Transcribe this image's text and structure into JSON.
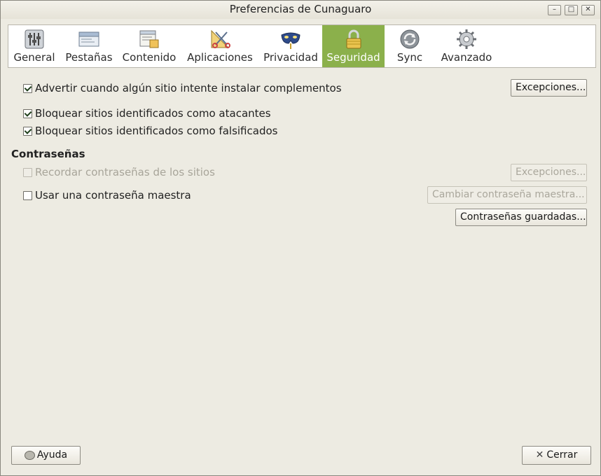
{
  "window": {
    "title": "Preferencias de Cunaguaro",
    "controls": [
      "minimize-icon",
      "maximize-icon",
      "close-icon"
    ]
  },
  "tabs": [
    {
      "label": "General",
      "icon": "sliders-icon",
      "selected": false
    },
    {
      "label": "Pestañas",
      "icon": "tabs-icon",
      "selected": false
    },
    {
      "label": "Contenido",
      "icon": "content-icon",
      "selected": false
    },
    {
      "label": "Aplicaciones",
      "icon": "applications-icon",
      "selected": false
    },
    {
      "label": "Privacidad",
      "icon": "mask-icon",
      "selected": false
    },
    {
      "label": "Seguridad",
      "icon": "lock-icon",
      "selected": true
    },
    {
      "label": "Sync",
      "icon": "sync-icon",
      "selected": false
    },
    {
      "label": "Avanzado",
      "icon": "gear-icon",
      "selected": false
    }
  ],
  "security": {
    "warn_addons": {
      "label": "Advertir cuando algún sitio intente instalar complementos",
      "checked": true
    },
    "exceptions_label": "Excepciones...",
    "block_attack": {
      "label": "Bloquear sitios identificados como atacantes",
      "checked": true
    },
    "block_forgery": {
      "label": "Bloquear sitios identificados como falsificados",
      "checked": true
    }
  },
  "passwords": {
    "heading": "Contraseñas",
    "remember": {
      "label": "Recordar contraseñas de los sitios",
      "checked": false,
      "disabled": true
    },
    "exceptions_label": "Excepciones...",
    "master": {
      "label": "Usar una contraseña maestra",
      "checked": false
    },
    "change_master_label": "Cambiar contraseña maestra...",
    "saved_label": "Contraseñas guardadas..."
  },
  "footer": {
    "help_label": "Ayuda",
    "close_label": "Cerrar"
  },
  "colors": {
    "selected_tab": "#8bb04b",
    "background": "#edebe2"
  }
}
